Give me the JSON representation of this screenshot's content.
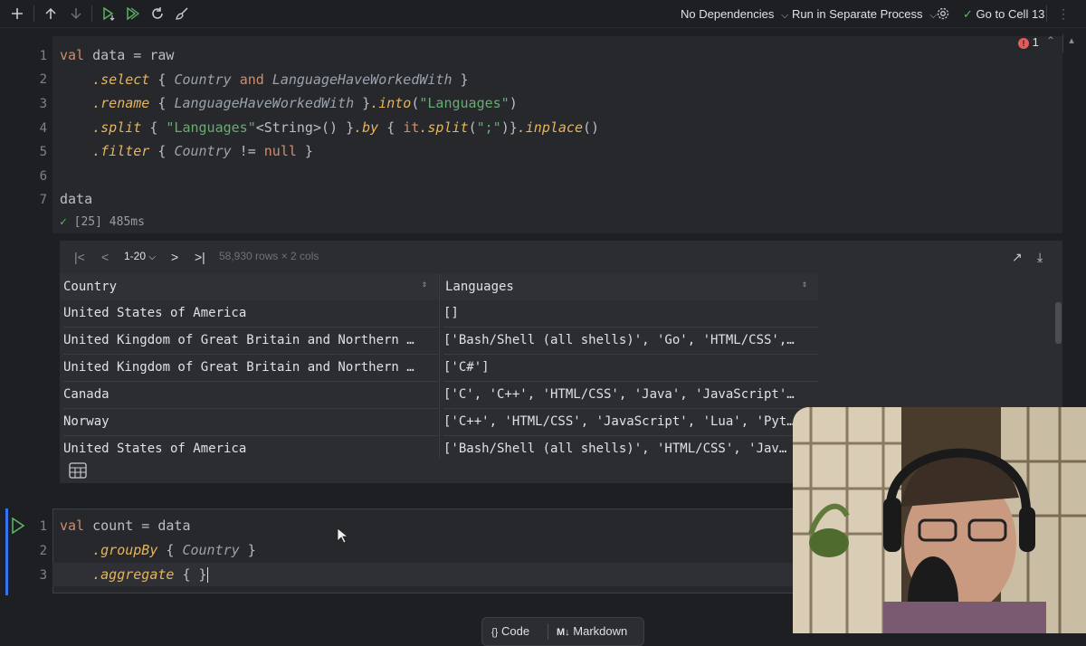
{
  "toolbar": {
    "dependencies_label": "No Dependencies",
    "run_mode_label": "Run in Separate Process",
    "goto_cell_label": "Go to Cell 13",
    "error_count": "1"
  },
  "cell1": {
    "line_numbers": [
      "1",
      "2",
      "3",
      "4",
      "5",
      "6",
      "7"
    ],
    "exec_status": "[25] 485ms"
  },
  "table": {
    "page_range": "1-20",
    "summary": "58,930 rows × 2 cols",
    "columns": [
      "Country",
      "Languages"
    ],
    "rows": [
      [
        "United States of America",
        "[]"
      ],
      [
        "United Kingdom of Great Britain and Northern …",
        "['Bash/Shell (all shells)', 'Go', 'HTML/CSS',…"
      ],
      [
        "United Kingdom of Great Britain and Northern …",
        "['C#']"
      ],
      [
        "Canada",
        "['C', 'C++', 'HTML/CSS', 'Java', 'JavaScript'…"
      ],
      [
        "Norway",
        "['C++', 'HTML/CSS', 'JavaScript', 'Lua', 'Pyt…"
      ],
      [
        "United States of America",
        "['Bash/Shell (all shells)', 'HTML/CSS', 'Jav…"
      ]
    ]
  },
  "cell2": {
    "line_numbers": [
      "1",
      "2",
      "3"
    ]
  },
  "bottom": {
    "code_label": "Code",
    "markdown_label": "Markdown"
  },
  "colors": {
    "keyword": "#cf8e6d",
    "function": "#e6b45d",
    "string": "#6aab73",
    "success": "#5fb865",
    "error": "#e55b5b"
  }
}
